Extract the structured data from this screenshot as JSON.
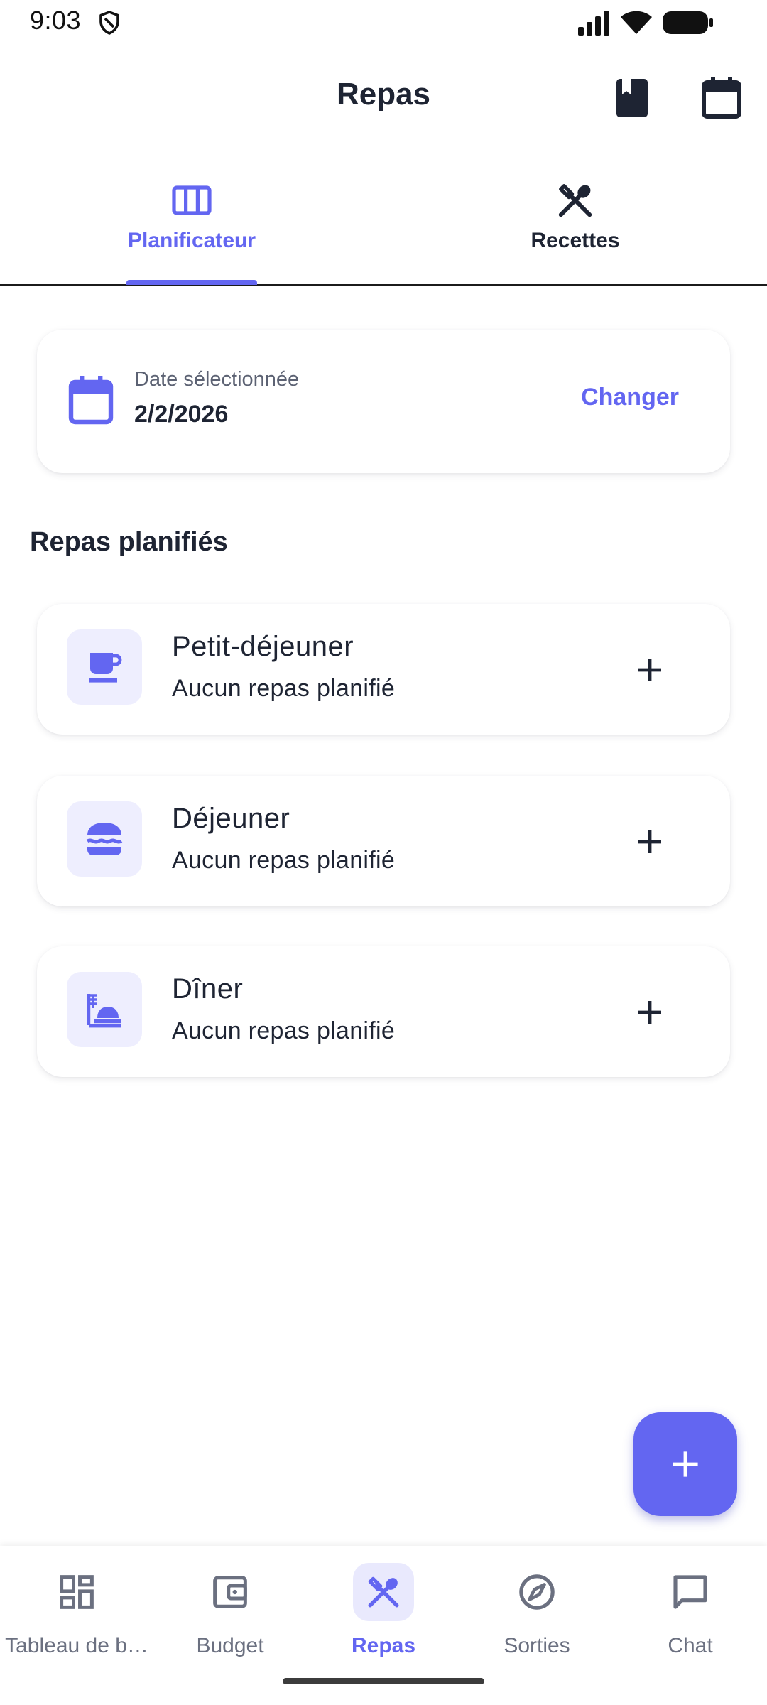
{
  "status_bar": {
    "time": "9:03"
  },
  "app_bar": {
    "title": "Repas"
  },
  "tabs": [
    {
      "label": "Planificateur",
      "icon": "view-week-icon",
      "active": true
    },
    {
      "label": "Recettes",
      "icon": "fork-knife-icon",
      "active": false
    }
  ],
  "date_card": {
    "caption": "Date sélectionnée",
    "value": "2/2/2026",
    "change_label": "Changer"
  },
  "planned_meals": {
    "title": "Repas planifiés",
    "items": [
      {
        "name": "Petit-déjeuner",
        "status": "Aucun repas planifié",
        "icon": "coffee-icon"
      },
      {
        "name": "Déjeuner",
        "status": "Aucun repas planifié",
        "icon": "burger-icon"
      },
      {
        "name": "Dîner",
        "status": "Aucun repas planifié",
        "icon": "dinner-icon"
      }
    ]
  },
  "bottom_nav": [
    {
      "label": "Tableau de b…",
      "icon": "dashboard-icon",
      "active": false
    },
    {
      "label": "Budget",
      "icon": "wallet-icon",
      "active": false
    },
    {
      "label": "Repas",
      "icon": "fork-knife-icon",
      "active": true
    },
    {
      "label": "Sorties",
      "icon": "compass-icon",
      "active": false
    },
    {
      "label": "Chat",
      "icon": "chat-icon",
      "active": false
    }
  ],
  "colors": {
    "accent": "#6366f1",
    "text_primary": "#1e2433",
    "text_secondary": "#5c6273",
    "icon_bg": "#eeeefe"
  }
}
